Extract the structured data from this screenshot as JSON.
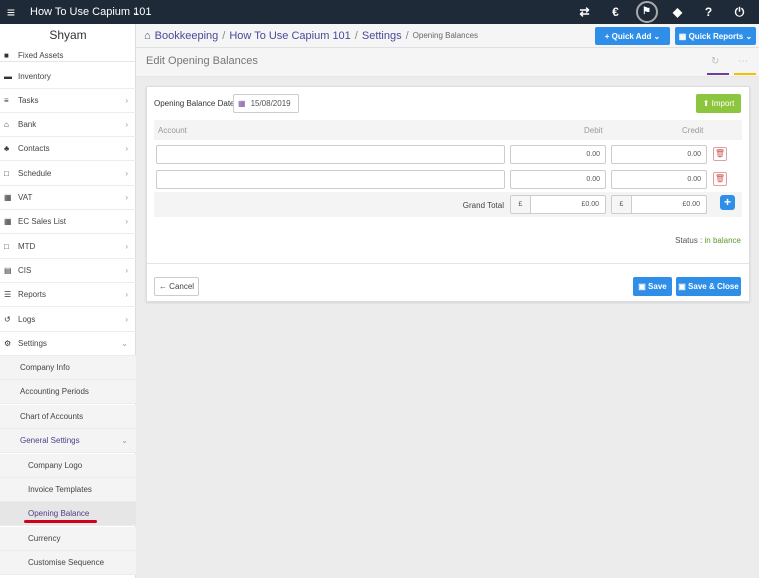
{
  "topbar": {
    "menu_icon": "hamburger-icon",
    "company": "How To Use Capium 101",
    "caret": "⌄",
    "icons": [
      "⇄",
      "€",
      "⚑",
      "◆",
      "?",
      "⏻"
    ]
  },
  "sidebar": {
    "user": "Shyam",
    "items": [
      {
        "label": "Fixed Assets",
        "icon": "■"
      },
      {
        "label": "Inventory",
        "icon": "▬"
      },
      {
        "label": "Tasks",
        "icon": "≡"
      },
      {
        "label": "Bank",
        "icon": "⌂"
      },
      {
        "label": "Contacts",
        "icon": "♣"
      },
      {
        "label": "Schedule",
        "icon": "□"
      },
      {
        "label": "VAT",
        "icon": "▦"
      },
      {
        "label": "EC Sales List",
        "icon": "▦"
      },
      {
        "label": "MTD",
        "icon": "□"
      },
      {
        "label": "CIS",
        "icon": "▤"
      },
      {
        "label": "Reports",
        "icon": "☰"
      },
      {
        "label": "Logs",
        "icon": "↺"
      },
      {
        "label": "Settings",
        "icon": "⚙"
      }
    ],
    "settings_sub": [
      "Company Info",
      "Accounting Periods",
      "Chart of Accounts",
      "General Settings"
    ],
    "general_sub": [
      "Company Logo",
      "Invoice Templates",
      "Opening Balance",
      "Currency",
      "Customise Sequence"
    ]
  },
  "breadcrumb": {
    "home_icon": "home-icon",
    "bookkeeping": "Bookkeeping",
    "company": "How To Use Capium 101",
    "settings": "Settings",
    "current": "Opening Balances",
    "sep": "/"
  },
  "quick": {
    "add": "+ Quick Add ⌄",
    "reports": "▦ Quick Reports ⌄"
  },
  "page": {
    "title": "Edit Opening Balances"
  },
  "form": {
    "date_label": "Opening Balance Date",
    "date_value": "15/08/2019",
    "import": "⬆ Import",
    "col_account": "Account",
    "col_debit": "Debit",
    "col_credit": "Credit",
    "rows": [
      {
        "account": "",
        "debit": "0.00",
        "credit": "0.00"
      },
      {
        "account": "",
        "debit": "0.00",
        "credit": "0.00"
      }
    ],
    "grand_total_label": "Grand Total",
    "currency_symbol": "£",
    "debit_total": "£0.00",
    "credit_total": "£0.00",
    "status_label": "Status : ",
    "status_value": "in balance",
    "cancel": "← Cancel",
    "save": "▣ Save",
    "save_close": "▣ Save & Close"
  },
  "colors": {
    "topbar": "#1e2a38",
    "accent_blue": "#2f8fe8",
    "import_green": "#8cc63f",
    "underline_red": "#d0021b",
    "purple_tab": "#6a3fa0",
    "yellow_tab": "#f2c200"
  }
}
